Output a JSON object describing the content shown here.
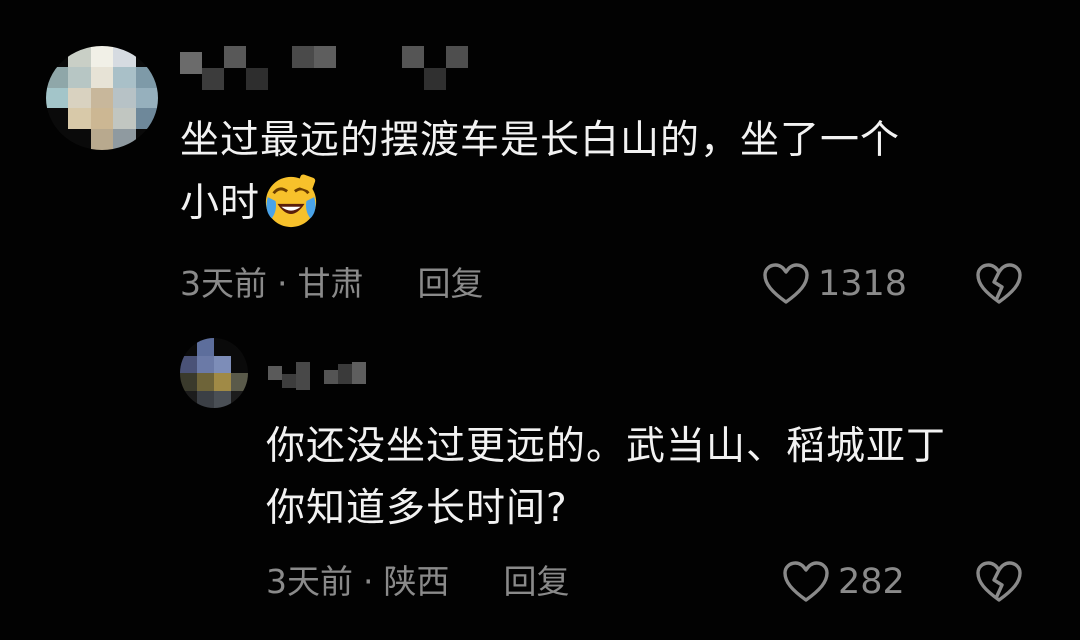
{
  "comment": {
    "avatar_icon": "blurred-avatar-icon",
    "text_line1": "坐过最远的摆渡车是长白山的，坐了一个",
    "text_line2": "小时",
    "emoji": "crying-laughing-emoji-icon",
    "time": "3天前",
    "separator": "·",
    "location": "甘肃",
    "reply_label": "回复",
    "like_count": "1318"
  },
  "reply": {
    "avatar_icon": "blurred-avatar-icon",
    "text_line1": "你还没坐过更远的。武当山、稻城亚丁",
    "text_line2": "你知道多长时间?",
    "time": "3天前",
    "separator": "·",
    "location": "陕西",
    "reply_label": "回复",
    "like_count": "282"
  },
  "icons": {
    "like": "heart-outline-icon",
    "dislike": "broken-heart-icon"
  },
  "colors": {
    "background": "#020202",
    "text": "#f2f2f2",
    "meta": "#8a8a8a"
  }
}
